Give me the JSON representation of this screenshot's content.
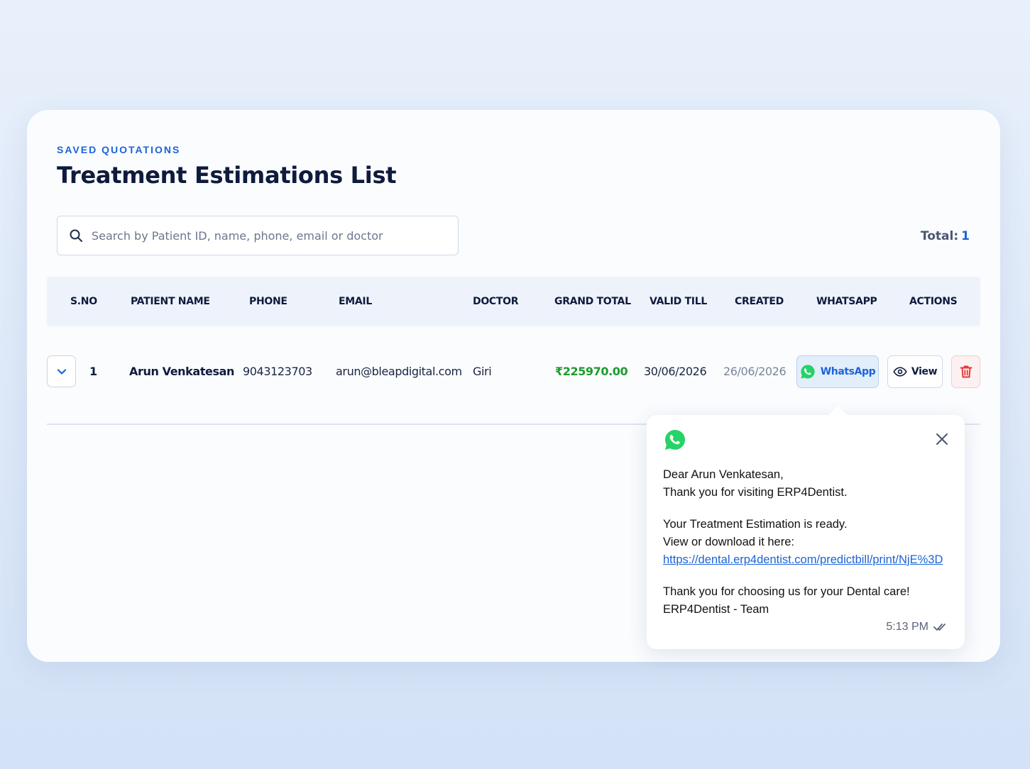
{
  "header": {
    "eyebrow": "SAVED QUOTATIONS",
    "title": "Treatment Estimations List"
  },
  "search": {
    "placeholder": "Search by Patient ID, name, phone, email or doctor",
    "value": ""
  },
  "total": {
    "label": "Total:",
    "value": "1"
  },
  "table": {
    "columns": [
      "S.NO",
      "PATIENT NAME",
      "PHONE",
      "EMAIL",
      "DOCTOR",
      "GRAND TOTAL",
      "VALID TILL",
      "CREATED",
      "WHATSAPP",
      "ACTIONS"
    ],
    "rows": [
      {
        "sno": "1",
        "patient_name": "Arun Venkatesan",
        "phone": "9043123703",
        "email": "arun@bleapdigital.com",
        "doctor": "Giri",
        "grand_total": "₹225970.00",
        "valid_till": "30/06/2026",
        "created": "26/06/2026",
        "whatsapp_label": "WhatsApp",
        "view_label": "View"
      }
    ]
  },
  "whatsapp_popup": {
    "line1": "Dear Arun Venkatesan,",
    "line2": "Thank you for visiting ERP4Dentist.",
    "line3": "Your Treatment Estimation is ready.",
    "line4": "View or download it here:",
    "link": "https://dental.erp4dentist.com/predictbill/print/NjE%3D",
    "line5": "Thank you for choosing us for your Dental care!",
    "line6": "ERP4Dentist - Team",
    "time": "5:13 PM"
  },
  "icons": {
    "search": "search-icon",
    "expand": "chevron-down-icon",
    "whatsapp": "whatsapp-icon",
    "view": "eye-icon",
    "delete": "trash-icon",
    "close": "close-icon",
    "read_receipt": "double-check-icon"
  },
  "colors": {
    "accent": "#1b63d8",
    "amount_green": "#1d9b2e",
    "whatsapp_green": "#25d366",
    "danger": "#e23b3b"
  }
}
